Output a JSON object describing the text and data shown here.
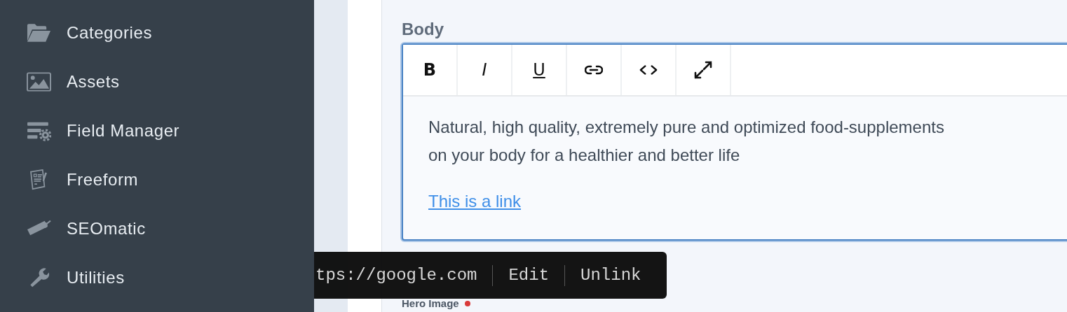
{
  "sidebar": {
    "items": [
      {
        "label": "Categories"
      },
      {
        "label": "Assets"
      },
      {
        "label": "Field Manager"
      },
      {
        "label": "Freeform"
      },
      {
        "label": "SEOmatic"
      },
      {
        "label": "Utilities"
      }
    ]
  },
  "body_field": {
    "label": "Body",
    "toolbar": [
      {
        "kind": "bold",
        "label": "B"
      },
      {
        "kind": "italic",
        "label": "I"
      },
      {
        "kind": "underline",
        "label": "U"
      },
      {
        "kind": "link"
      },
      {
        "kind": "code"
      },
      {
        "kind": "expand"
      }
    ],
    "paragraph": "Natural, high quality, extremely pure and optimized food-supplements",
    "paragraph_line_2": "on your body for a healthier and better life",
    "link": "This is a link"
  },
  "link_tooltip": {
    "url": "tps://google.com",
    "actions": [
      "Edit",
      "Unlink"
    ]
  },
  "hero_field": {
    "label": "Hero Image",
    "required": true
  }
}
